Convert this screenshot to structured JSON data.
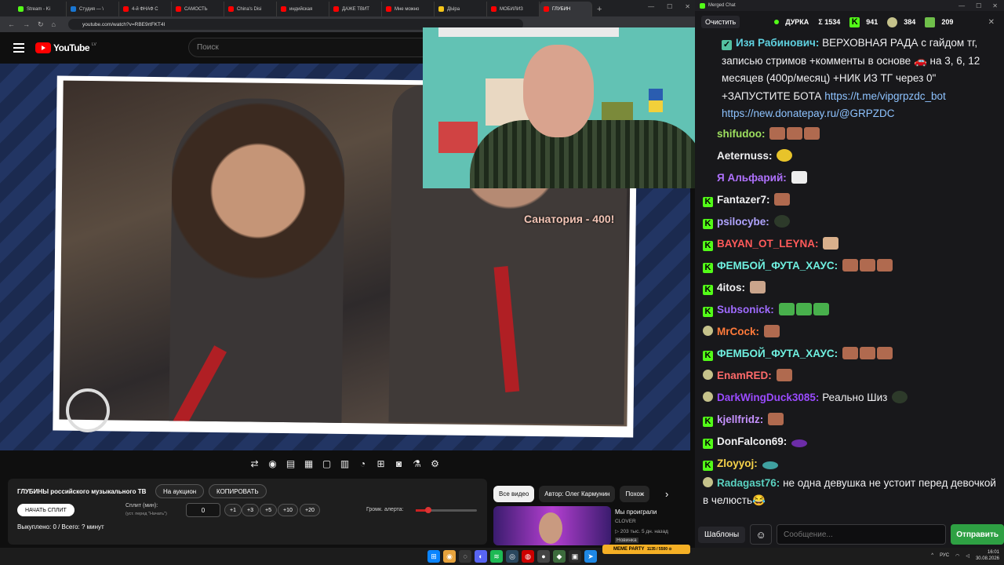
{
  "browser": {
    "tabs": [
      "Stream - Ki",
      "Студия — \\",
      "4-й ФНАФ С",
      "САМОСТЬ",
      "China's Disi",
      "индийская",
      "ДАЖЕ ТВИТ",
      "Мне можно",
      "ДЫра",
      "МОБИЛИЗ",
      "ГЛУБИН"
    ],
    "url": "youtube.com/watch?v=RBE9rtFKT4I"
  },
  "youtube": {
    "logo": "YouTube",
    "region": "LV",
    "search_placeholder": "Поиск"
  },
  "video": {
    "caption": "Санатория - 400!"
  },
  "controls_icons": [
    "repeat-icon",
    "broadcast-icon",
    "subtitles-icon",
    "clapper-icon",
    "frame-icon",
    "film-icon",
    "speed-icon",
    "add-icon",
    "camera-icon",
    "flask-icon",
    "gear-icon"
  ],
  "auction": {
    "title": "ГЛУБИНЫ российского музыкального ТВ",
    "on_auction": "На аукцион",
    "copy": "КОПИРОВАТЬ",
    "start_split": "НАЧАТЬ СПЛИТ",
    "split_label": "Сплит (мин):",
    "split_hint": "(уст. перед \"Начать\")",
    "split_value": "0",
    "steps": [
      "+1",
      "+3",
      "+5",
      "+10",
      "+20"
    ],
    "volume_label": "Громк. алерта:",
    "volume_level": 0.2,
    "bought": "Выкуплено: 0 / Всего: ? минут"
  },
  "related": {
    "chips": [
      "Все видео",
      "Автор: Олег Кармунин",
      "Похож"
    ],
    "video_title": "Мы проиграли",
    "channel": "CLOVER",
    "meta": "▷ 203 тыс.   5 дн. назад",
    "meta2": "Новинка"
  },
  "chat": {
    "window_title": "Merged Chat",
    "clear": "Очистить",
    "channel": "ДУРКА",
    "stats": {
      "sigma": "Σ 1534",
      "kick": "941",
      "yellow": "384",
      "green": "209"
    },
    "messages": [
      {
        "user": "Изя Рабинович:",
        "color": "#5fd1e0",
        "badge": "check",
        "text": "ВЕРХОВНАЯ РАДА с гайдом тг, записью стримов +комменты в основе 🚗 на 3, 6, 12 месяцев (400р/месяц) +НИК ИЗ ТГ через 0\" +ЗАПУСТИТЕ БОТА",
        "link1": "https://t.me/vipgrpzdc_bot",
        "link2": "https://new.donatepay.ru/@GRPZDC"
      },
      {
        "user": "shifudoo:",
        "color": "#9ee05f",
        "badge": "",
        "emotes": 3
      },
      {
        "user": "Aeternuss:",
        "color": "#efeff1",
        "badge": "",
        "emotes": 1
      },
      {
        "user": "Я Альфарий:",
        "color": "#b072ff",
        "badge": "",
        "emotes": 1
      },
      {
        "user": "Fantazer7:",
        "color": "#efeff1",
        "badge": "k",
        "emotes": 1
      },
      {
        "user": "psilocybe:",
        "color": "#b0a4ff",
        "badge": "k",
        "emotes": 1
      },
      {
        "user": "BAYAN_OT_LEYNA:",
        "color": "#ff5a5a",
        "badge": "k",
        "emotes": 1
      },
      {
        "user": "ФЕМБОЙ_ФУТА_ХАУС:",
        "color": "#6ff0e0",
        "badge": "k",
        "emotes": 3
      },
      {
        "user": "4itos:",
        "color": "#efeff1",
        "badge": "k",
        "emotes": 1
      },
      {
        "user": "Subsonick:",
        "color": "#9f6bff",
        "badge": "k",
        "emotes": 3
      },
      {
        "user": "MrCock:",
        "color": "#ff7a3a",
        "badge": "g",
        "emotes": 1
      },
      {
        "user": "ФЕМБОЙ_ФУТА_ХАУС:",
        "color": "#6ff0e0",
        "badge": "k",
        "emotes": 3
      },
      {
        "user": "EnamRED:",
        "color": "#ff6a6a",
        "badge": "g",
        "emotes": 1
      },
      {
        "user": "DarkWingDuck3085:",
        "color": "#9a4bff",
        "badge": "g",
        "text": "Реально Шиз",
        "emotes": 1
      },
      {
        "user": "kjellfridz:",
        "color": "#c692ff",
        "badge": "k",
        "emotes": 1
      },
      {
        "user": "DonFalcon69:",
        "color": "#efeff1",
        "badge": "k",
        "emotes": 1
      },
      {
        "user": "Zloyyoj:",
        "color": "#f7d34a",
        "badge": "k",
        "emotes": 1
      },
      {
        "user": "Radagast76:",
        "color": "#5ad1c0",
        "badge": "g",
        "text": "не одна девушка не устоит перед девочкой в челюсть😂"
      }
    ],
    "templates": "Шаблоны",
    "input_placeholder": "Сообщение...",
    "send": "Отправить"
  },
  "taskbar": {
    "alert": "MEME PARTY",
    "alert_sub": "1135 / 5500 ⊙",
    "lang": "РУС",
    "time": "16:01",
    "date": "30.08.2026"
  }
}
